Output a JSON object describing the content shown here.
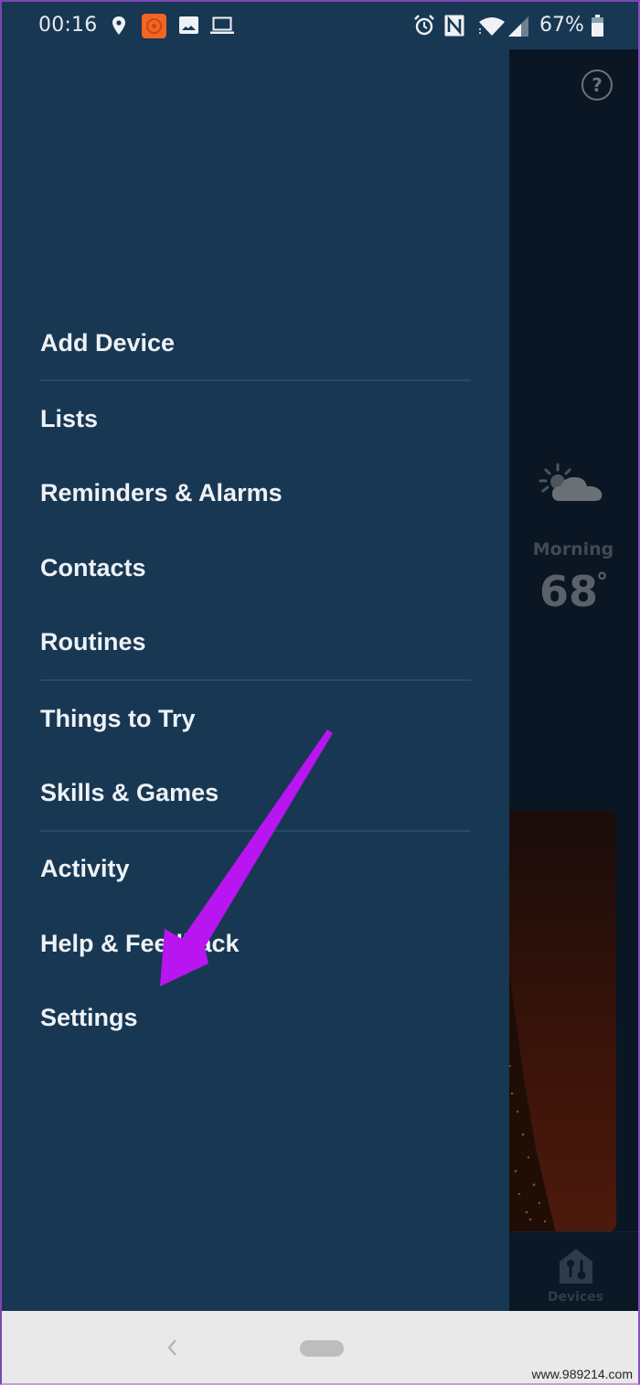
{
  "status_bar": {
    "time": "00:16",
    "left_icons": [
      "location-pin-icon",
      "orange-app-notification-icon",
      "image-icon",
      "laptop-icon"
    ],
    "right_icons": [
      "alarm-clock-icon",
      "nfc-icon",
      "wifi-icon",
      "cell-signal-icon",
      "battery-icon"
    ],
    "battery_percent": "67%"
  },
  "drawer": {
    "menu_items": [
      {
        "id": "add-device",
        "label": "Add Device"
      },
      {
        "id": "lists",
        "label": "Lists"
      },
      {
        "id": "reminders-alarms",
        "label": "Reminders & Alarms"
      },
      {
        "id": "contacts",
        "label": "Contacts"
      },
      {
        "id": "routines",
        "label": "Routines"
      },
      {
        "id": "things-to-try",
        "label": "Things to Try"
      },
      {
        "id": "skills-games",
        "label": "Skills & Games"
      },
      {
        "id": "activity",
        "label": "Activity"
      },
      {
        "id": "help-feedback",
        "label": "Help & Feedback"
      },
      {
        "id": "settings",
        "label": "Settings"
      }
    ]
  },
  "main_app": {
    "help_label": "?",
    "weather": {
      "icon": "partly-cloudy-icon",
      "period": "Morning",
      "temperature": "68",
      "degree_symbol": "°"
    },
    "bottom_nav": {
      "devices_label": "Devices"
    }
  },
  "annotation": {
    "type": "arrow",
    "color": "#b915f0",
    "points_to": "Settings"
  },
  "system_nav": {
    "back_icon": "back-chevron-icon",
    "home_icon": "home-pill-icon"
  },
  "watermark": "www.989214.com",
  "colors": {
    "drawer_bg": "#183753",
    "main_bg": "#0a1624",
    "menu_text": "#eef2f6",
    "divider": "#274a69",
    "notification_orange": "#f26522",
    "frame_border": "#7b45b4"
  }
}
